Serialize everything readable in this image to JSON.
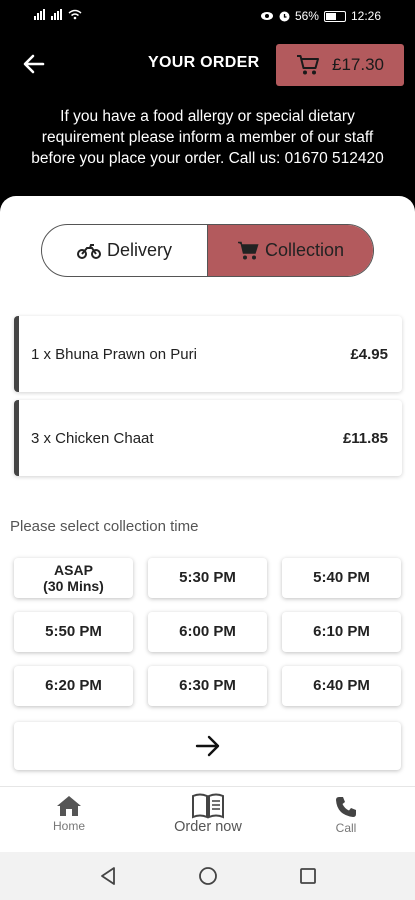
{
  "status_bar": {
    "time": "12:26",
    "battery_percent": "56%"
  },
  "header": {
    "title": "YOUR ORDER",
    "cart_total": "£17.30",
    "allergy_notice": "If you have a food allergy or special dietary requirement please inform a member of our staff before you place your order. Call us: 01670 512420"
  },
  "order_type": {
    "options": [
      {
        "label": "Delivery",
        "icon": "motorbike-icon",
        "active": false
      },
      {
        "label": "Collection",
        "icon": "cart-icon",
        "active": true
      }
    ]
  },
  "order_items": [
    {
      "label": "1 x Bhuna Prawn on Puri",
      "price": "£4.95"
    },
    {
      "label": "3 x Chicken Chaat",
      "price": "£11.85"
    }
  ],
  "collection_time": {
    "prompt": "Please select collection time",
    "slots": [
      {
        "line1": "ASAP",
        "line2": "(30 Mins)"
      },
      {
        "line1": "5:30 PM"
      },
      {
        "line1": "5:40 PM"
      },
      {
        "line1": "5:50 PM"
      },
      {
        "line1": "6:00 PM"
      },
      {
        "line1": "6:10 PM"
      },
      {
        "line1": "6:20 PM"
      },
      {
        "line1": "6:30 PM"
      },
      {
        "line1": "6:40 PM"
      }
    ]
  },
  "bottom_nav": {
    "home": "Home",
    "order_now": "Order now",
    "call": "Call"
  },
  "colors": {
    "accent": "#b35a5d",
    "header_bg": "#000000",
    "panel_bg": "#ffffff"
  }
}
